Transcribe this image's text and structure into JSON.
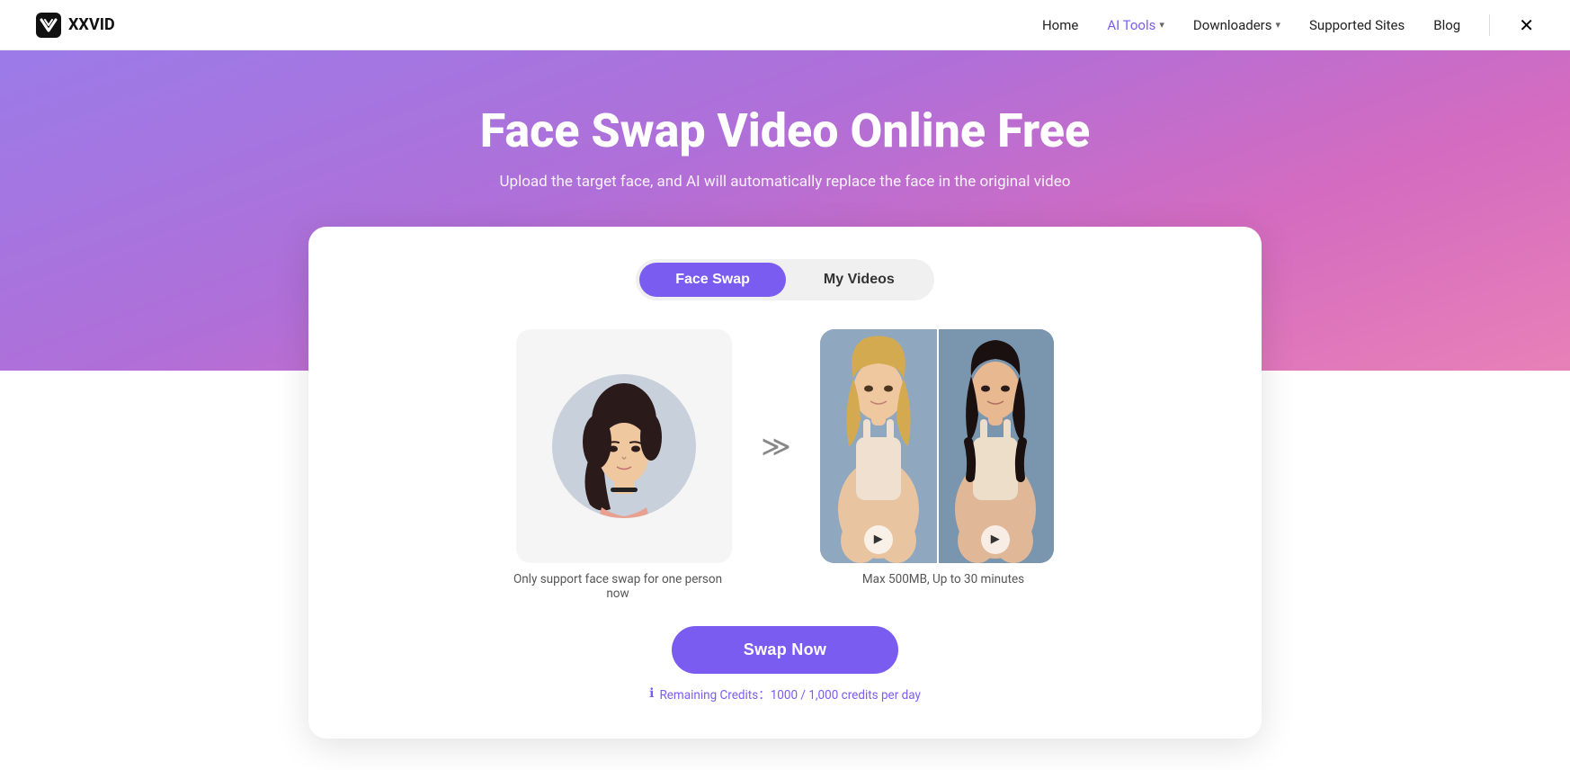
{
  "brand": {
    "name": "XXVID",
    "logo_alt": "XXVID logo"
  },
  "nav": {
    "links": [
      {
        "id": "home",
        "label": "Home",
        "active": false,
        "has_chevron": false
      },
      {
        "id": "ai-tools",
        "label": "AI Tools",
        "active": true,
        "has_chevron": true
      },
      {
        "id": "downloaders",
        "label": "Downloaders",
        "active": false,
        "has_chevron": true
      },
      {
        "id": "supported-sites",
        "label": "Supported Sites",
        "active": false,
        "has_chevron": false
      },
      {
        "id": "blog",
        "label": "Blog",
        "active": false,
        "has_chevron": false
      }
    ]
  },
  "hero": {
    "title": "Face Swap Video Online Free",
    "subtitle": "Upload the target face, and AI will automatically replace the face in the original video"
  },
  "tabs": [
    {
      "id": "face-swap",
      "label": "Face Swap",
      "active": true
    },
    {
      "id": "my-videos",
      "label": "My Videos",
      "active": false
    }
  ],
  "source": {
    "caption": "Only support face swap for one person now"
  },
  "target": {
    "caption": "Max 500MB, Up to 30 minutes"
  },
  "swap_button": {
    "label": "Swap Now"
  },
  "credits": {
    "text": "Remaining Credits：1000 / 1,000 credits per day",
    "icon": "ℹ"
  }
}
